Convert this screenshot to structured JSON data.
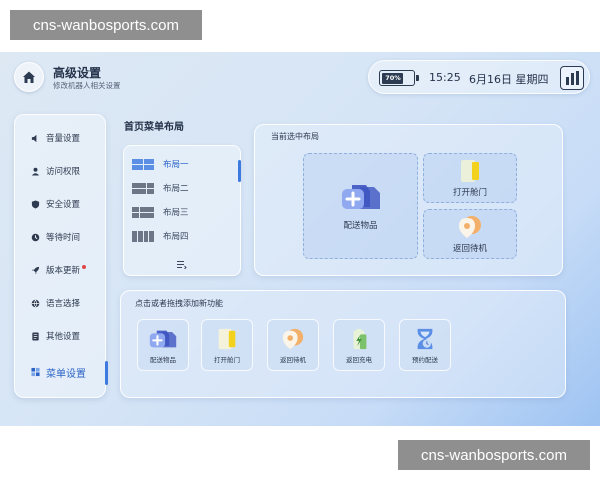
{
  "watermark": "cns-wanbosports.com",
  "header": {
    "title": "高级设置",
    "subtitle": "修改机器人相关设置"
  },
  "status": {
    "battery_text": "70%",
    "battery_level": 0.7,
    "time": "15:25",
    "date": "6月16日 星期四"
  },
  "sidebar": {
    "items": [
      {
        "label": "音量设置",
        "icon": "speaker-icon"
      },
      {
        "label": "访问权限",
        "icon": "user-icon"
      },
      {
        "label": "安全设置",
        "icon": "shield-icon"
      },
      {
        "label": "等待时间",
        "icon": "clock-icon"
      },
      {
        "label": "版本更新",
        "icon": "rocket-icon"
      },
      {
        "label": "语言选择",
        "icon": "globe-icon"
      },
      {
        "label": "其他设置",
        "icon": "document-icon"
      },
      {
        "label": "菜单设置",
        "icon": "grid-icon"
      }
    ],
    "active_index": 7
  },
  "home_layout": {
    "title": "首页菜单布局",
    "layouts": [
      "布局一",
      "布局二",
      "布局三",
      "布局四"
    ],
    "selected_index": 0
  },
  "current_layout": {
    "title": "当前选中布局",
    "slots": [
      "配送物品",
      "打开舱门",
      "返回待机"
    ]
  },
  "add_functions": {
    "title": "点击或者拖拽添加新功能",
    "items": [
      "配送物品",
      "打开舱门",
      "返回待机",
      "返回充电",
      "预约配送"
    ]
  },
  "colors": {
    "accent": "#3d7ae0",
    "text": "#24324a"
  }
}
